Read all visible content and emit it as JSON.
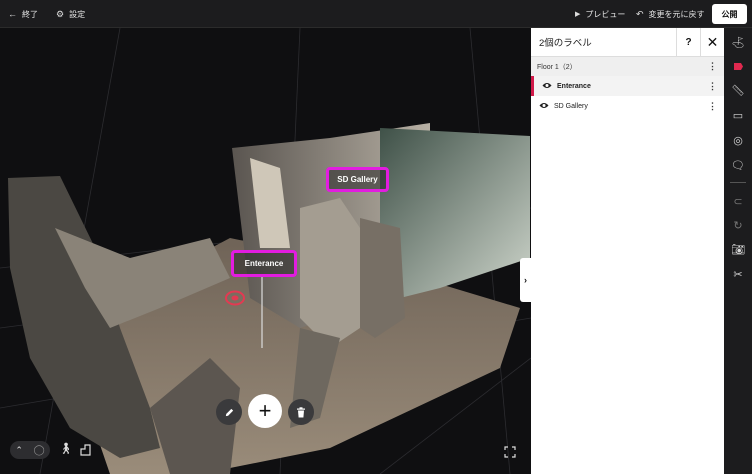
{
  "topbar": {
    "exit_label": "終了",
    "settings_label": "設定",
    "preview_label": "プレビュー",
    "revert_label": "変更を元に戻す",
    "publish_label": "公開"
  },
  "viewport": {
    "tags": [
      {
        "label": "Enterance"
      },
      {
        "label": "SD Gallery"
      }
    ],
    "add_button_glyph": "+",
    "collapse_glyph": "›"
  },
  "panel": {
    "title": "2個のラベル",
    "help_glyph": "?",
    "close_glyph": "✕",
    "floor_label": "Floor 1（2）",
    "labels": [
      {
        "name": "Enterance",
        "selected": true
      },
      {
        "name": "SD Gallery",
        "selected": false
      }
    ]
  },
  "colors": {
    "accent": "#e21ce0",
    "selected_marker": "#d11a4a",
    "toolbar_active": "#e0294f"
  }
}
